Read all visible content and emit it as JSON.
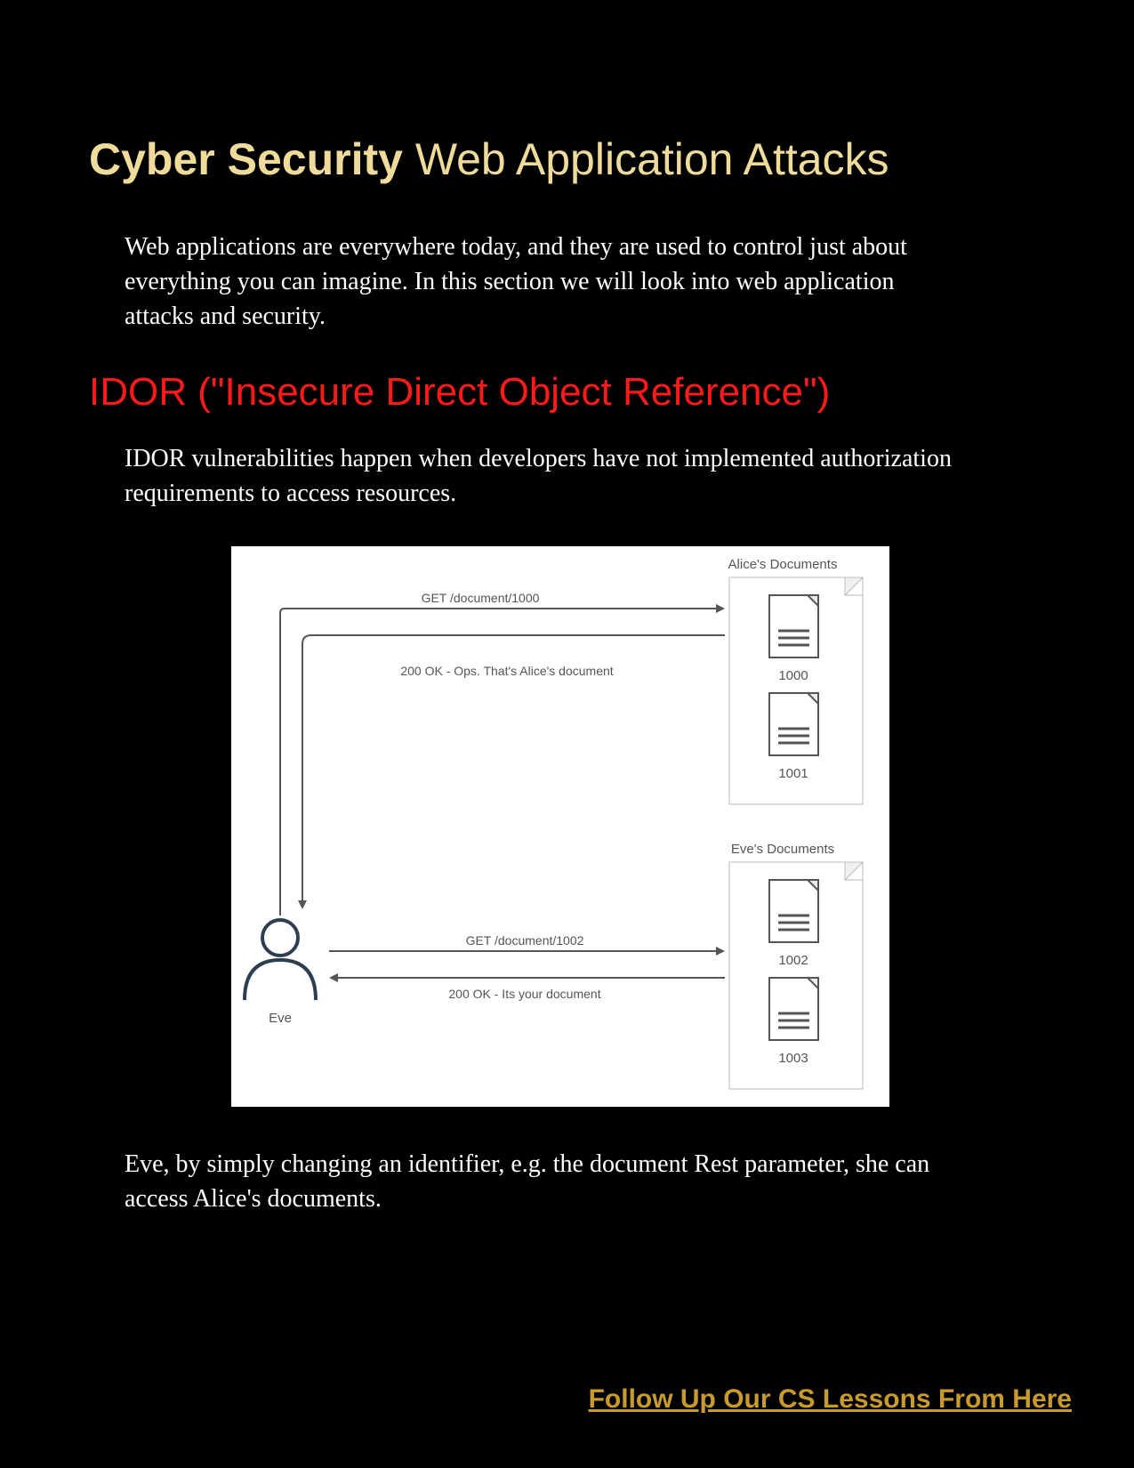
{
  "title": {
    "bold": "Cyber Security",
    "light": " Web Application Attacks"
  },
  "intro": "Web applications are everywhere today, and they are used to control just about everything you can imagine. In this section we will look into web application attacks and security.",
  "section_heading": "IDOR (\"Insecure Direct Object Reference\")",
  "idor_desc": "IDOR vulnerabilities happen when developers have not implemented authorization requirements to access resources.",
  "diagram": {
    "alice_label": "Alice's Documents",
    "eve_label": "Eve's Documents",
    "user_label": "Eve",
    "req1": "GET /document/1000",
    "resp1": "200 OK - Ops. That's Alice's document",
    "req2": "GET /document/1002",
    "resp2": "200 OK - Its your document",
    "doc_ids": [
      "1000",
      "1001",
      "1002",
      "1003"
    ]
  },
  "conclusion": "Eve, by simply changing an identifier, e.g. the document Rest parameter, she can access Alice's documents.",
  "footer_link": "Follow Up Our CS Lessons From Here"
}
